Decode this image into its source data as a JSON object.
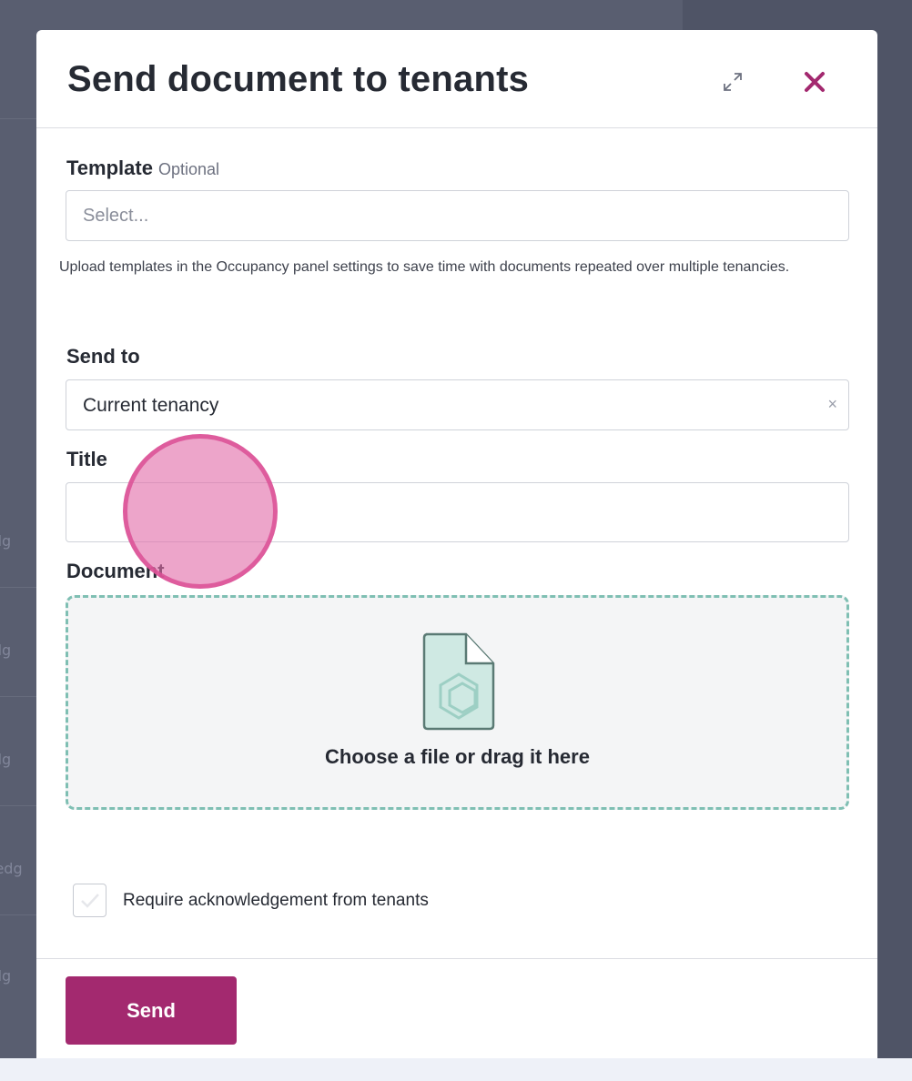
{
  "background": {
    "row_texts": [
      "edg",
      "edg",
      "edg",
      "ledg",
      "edg"
    ]
  },
  "modal": {
    "title": "Send document to tenants",
    "expand_icon": "expand-icon",
    "close_icon": "close-icon",
    "template": {
      "label": "Template",
      "optional": "Optional",
      "placeholder": "Select...",
      "help": "Upload templates in the Occupancy panel settings to save time with documents repeated over multiple tenancies."
    },
    "send_to": {
      "label": "Send to",
      "value": "Current tenancy",
      "clear": "×"
    },
    "title_field": {
      "label": "Title",
      "value": ""
    },
    "document": {
      "label": "Document",
      "dropzone_text": "Choose a file or drag it here",
      "icon": "file-icon"
    },
    "acknowledgement": {
      "label": "Require acknowledgement from tenants",
      "checked": false
    },
    "send_button": "Send"
  },
  "colors": {
    "accent": "#a3296f",
    "dropzone_border": "#7fbfb3",
    "overlay": "#4f5466"
  }
}
